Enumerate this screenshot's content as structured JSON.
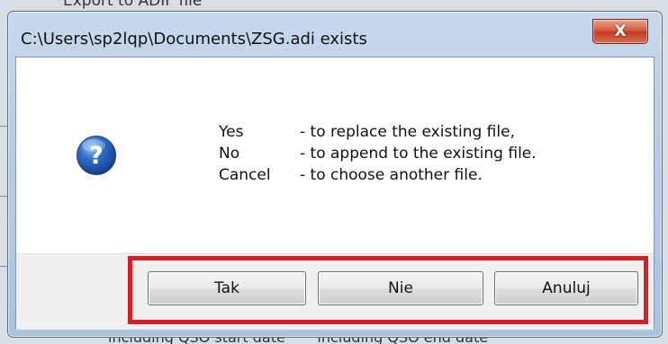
{
  "dialog": {
    "title": "C:\\Users\\sp2lqp\\Documents\\ZSG.adi exists",
    "close_label": "X"
  },
  "message": {
    "lines": [
      {
        "key": "Yes",
        "text": "- to replace the existing file,"
      },
      {
        "key": "No",
        "text": "- to append to the existing file."
      },
      {
        "key": "Cancel",
        "text": "- to choose another file."
      }
    ]
  },
  "buttons": {
    "yes_label": "Tak",
    "no_label": "Nie",
    "cancel_label": "Anuluj"
  },
  "icons": {
    "message_icon": "question-icon",
    "close_icon": "close-icon"
  },
  "colors": {
    "highlight": "#d81f26",
    "close_button": "#c23a22",
    "icon_blue": "#1f4fa8"
  }
}
